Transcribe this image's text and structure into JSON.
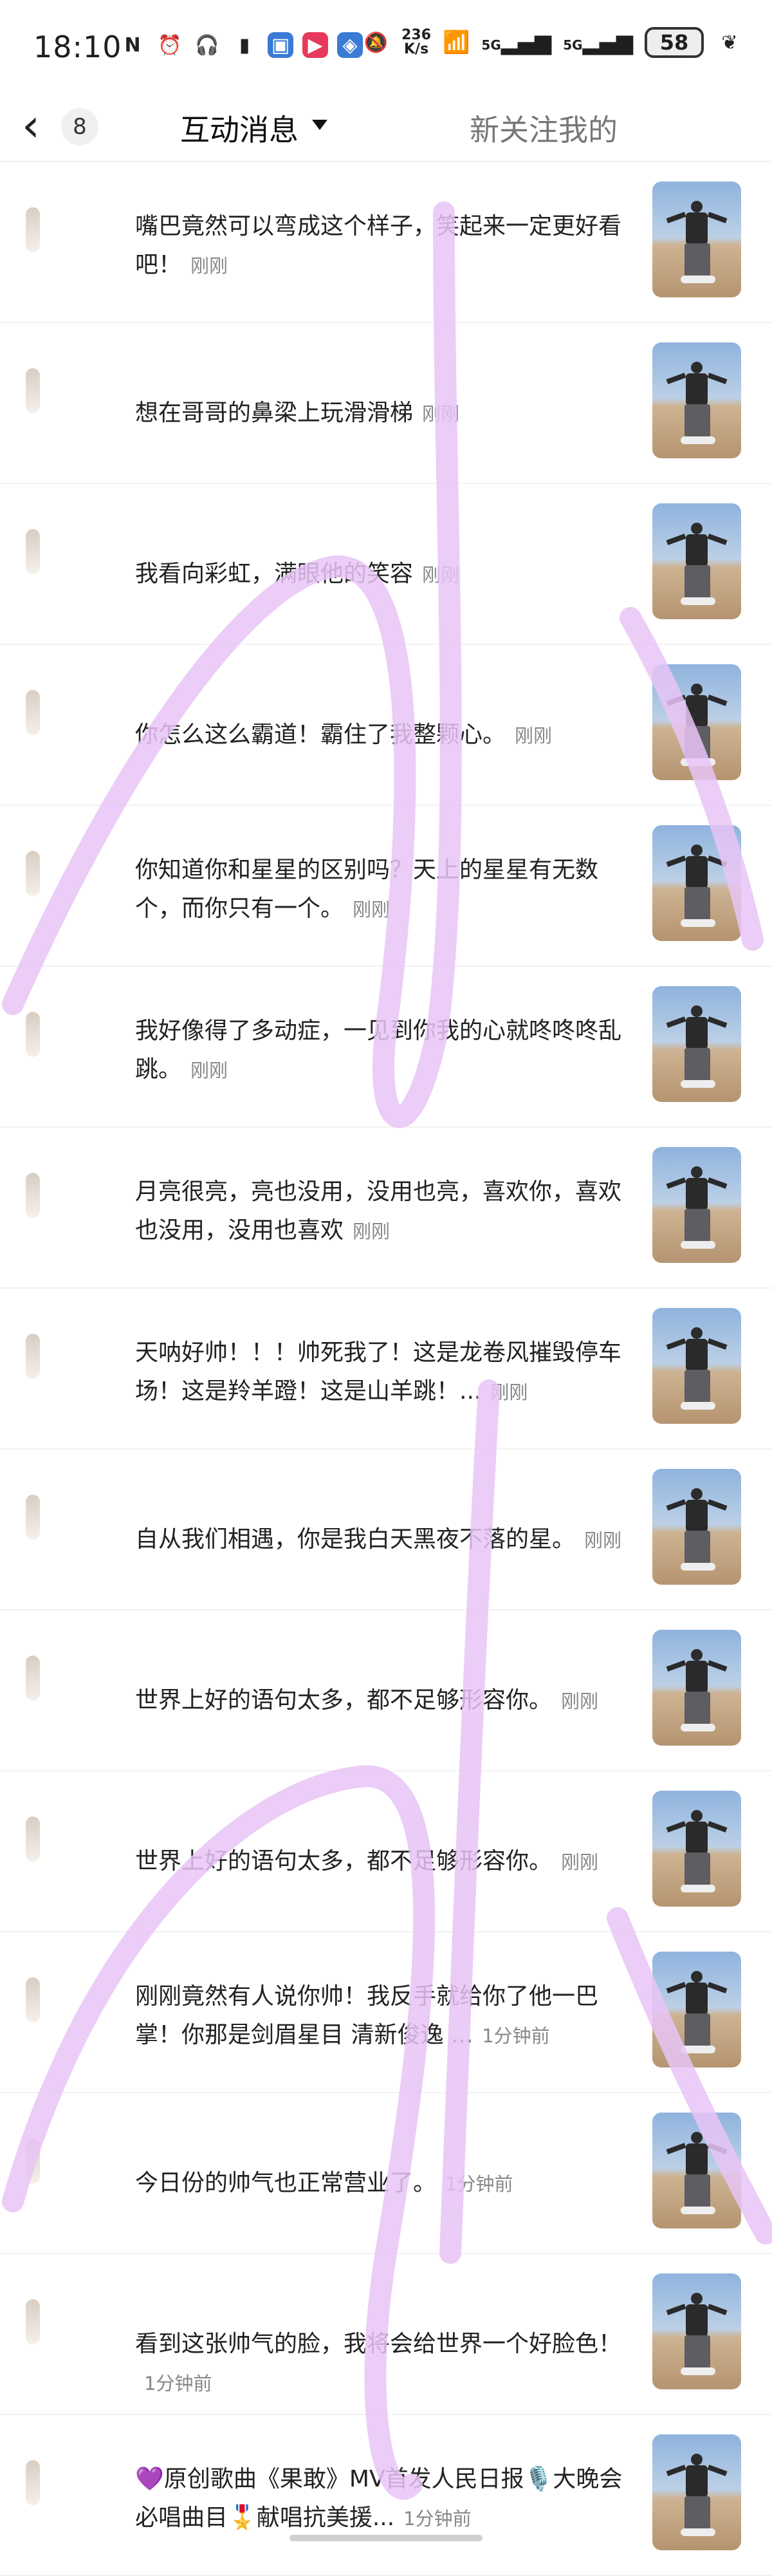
{
  "status_bar": {
    "time": "18:10",
    "net_speed_value": "236",
    "net_speed_unit": "K/s",
    "signal1": "5G",
    "signal2": "5G",
    "battery": "58"
  },
  "nav": {
    "back_count": "8",
    "title": "互动消息",
    "tab_follow": "新关注我的"
  },
  "messages": [
    {
      "text": "嘴巴竟然可以弯成这个样子，笑起来一定更好看吧！",
      "time": "刚刚"
    },
    {
      "text": "想在哥哥的鼻梁上玩滑滑梯",
      "time": "刚刚"
    },
    {
      "text": "我看向彩虹，满眼他的笑容",
      "time": "刚刚"
    },
    {
      "text": "你怎么这么霸道！霸住了我整颗心。",
      "time": "刚刚"
    },
    {
      "text": "你知道你和星星的区别吗？天上的星星有无数个，而你只有一个。",
      "time": "刚刚"
    },
    {
      "text": "我好像得了多动症，一见到你我的心就咚咚咚乱跳。",
      "time": "刚刚"
    },
    {
      "text": "月亮很亮，亮也没用，没用也亮，喜欢你，喜欢也没用，没用也喜欢",
      "time": "刚刚"
    },
    {
      "text": "天呐好帅！！！帅死我了！这是龙卷风摧毁停车场！这是羚羊蹬！这是山羊跳！...",
      "time": "刚刚"
    },
    {
      "text": "自从我们相遇，你是我白天黑夜不落的星。",
      "time": "刚刚"
    },
    {
      "text": "世界上好的语句太多，都不足够形容你。",
      "time": "刚刚"
    },
    {
      "text": "世界上好的语句太多，都不足够形容你。",
      "time": "刚刚"
    },
    {
      "text": "刚刚竟然有人说你帅！我反手就给你了他一巴掌！你那是剑眉星目 清新俊逸 ...",
      "time": "1分钟前"
    },
    {
      "text": "今日份的帅气也正常营业了。",
      "time": "1分钟前"
    },
    {
      "text": "看到这张帅气的脸，我将会给世界一个好脸色！",
      "time": "1分钟前"
    },
    {
      "text": "💜原创歌曲《果敢》MV首发人民日报🎙️大晚会必唱曲目🎖️献唱抗美援...",
      "time": "1分钟前"
    }
  ],
  "colors": {
    "scribble": "#e7c4f6",
    "time_text": "#888888"
  }
}
